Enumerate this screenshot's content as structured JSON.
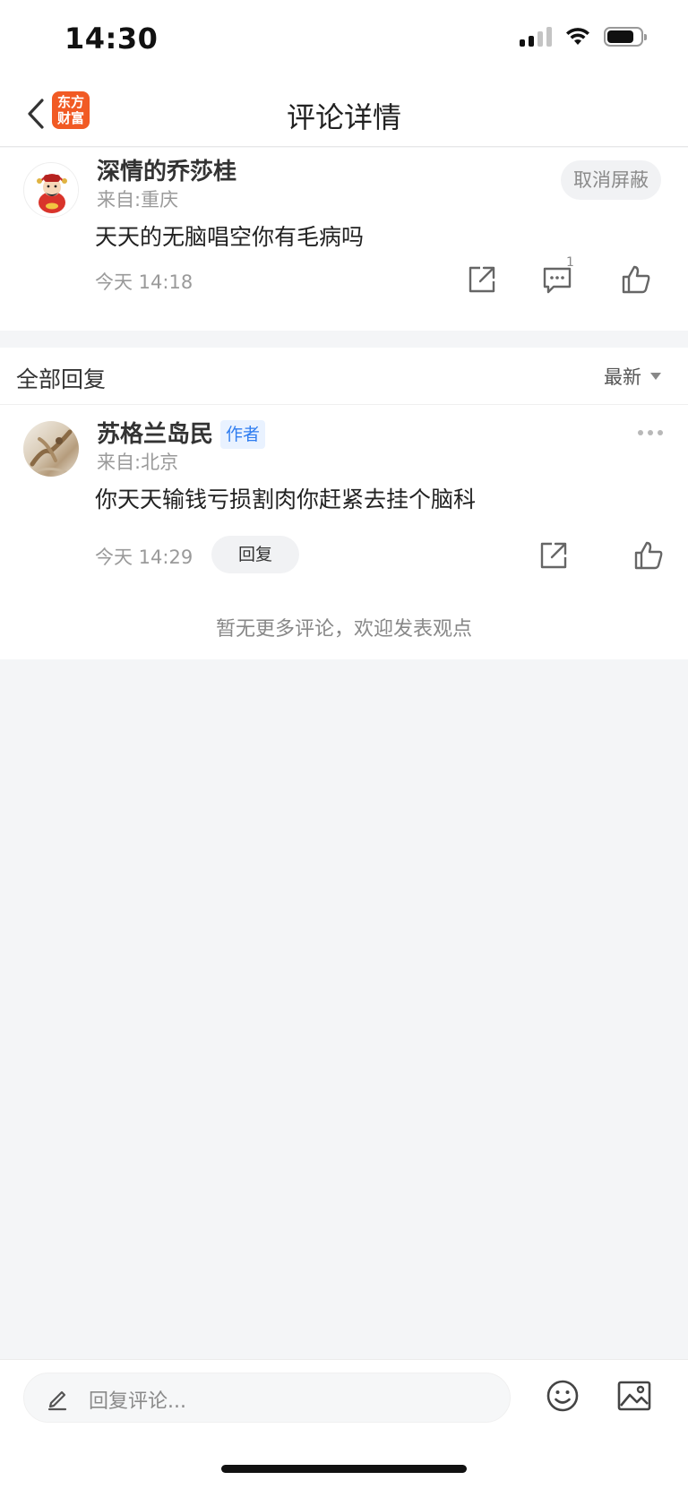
{
  "status_bar": {
    "time": "14:30",
    "battery_level": 0.72,
    "signal_bars": 4,
    "signal_active": 2
  },
  "nav": {
    "title": "评论详情",
    "logo_line1": "东方",
    "logo_line2": "财富"
  },
  "main_comment": {
    "user_name": "深情的乔莎桂",
    "location": "来自:重庆",
    "text": "天天的无脑唱空你有毛病吗",
    "time": "今天 14:18",
    "unblock_label": "取消屏蔽",
    "reply_count": "1"
  },
  "replies": {
    "title": "全部回复",
    "sort_label": "最新",
    "items": [
      {
        "user_name": "苏格兰岛民",
        "badge": "作者",
        "location": "来自:北京",
        "text": "你天天输钱亏损割肉你赶紧去挂个脑科",
        "time": "今天 14:29",
        "reply_label": "回复"
      }
    ],
    "no_more_text": "暂无更多评论，欢迎发表观点"
  },
  "bottom_bar": {
    "placeholder": "回复评论..."
  },
  "colors": {
    "brand": "#f15a24",
    "badge_blue": "#2f7df0",
    "page_bg": "#f4f5f7"
  }
}
